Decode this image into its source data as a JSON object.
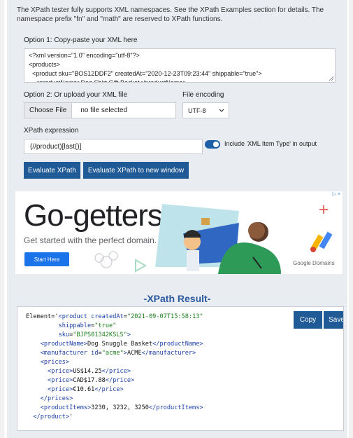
{
  "note": "The XPath tester fully supports XML namespaces. See the XPath Examples section for details. The namespace prefix \"fn\" and \"math\" are reserved to XPath functions.",
  "option1": {
    "label": "Option 1: Copy-paste your XML here",
    "xml_lines": [
      "<?xml version=\"1.0\" encoding=\"utf-8\"?>",
      "<products>",
      "  <product sku=\"BOS12DDF2\" createdAt=\"2020-12-23T09:23:44\" shippable=\"true\">",
      "    <productName>Dog Shirt Gift Basket</productName>"
    ]
  },
  "option2": {
    "label": "Option 2: Or upload your XML file",
    "choose_button": "Choose File",
    "no_file": "no file selected"
  },
  "encoding": {
    "label": "File encoding",
    "selected": "UTF-8"
  },
  "xpath": {
    "label": "XPath expression",
    "value": "(//product)[last()]",
    "toggle_label": "Include 'XML Item Type' in output",
    "toggle_on": true
  },
  "buttons": {
    "evaluate": "Evaluate XPath",
    "evaluate_new_window": "Evaluate XPath to new window"
  },
  "ad": {
    "headline": "Go-getters.",
    "subline": "Get started with the perfect domain.",
    "cta": "Start Here",
    "brand": "Google Domains"
  },
  "result": {
    "title": "-XPath Result-",
    "copy": "Copy",
    "save": "Save",
    "lines": [
      "Element='<product createdAt=\"2021-09-07T15:58:13\"",
      "         shippable=\"true\"",
      "         sku=\"BJPS01342KSLS\">",
      "    <productName>Dog Snuggle Basket</productName>",
      "    <manufacturer id=\"acme\">ACME</manufacturer>",
      "    <prices>",
      "      <price>US$14.25</price>",
      "      <price>CAD$17.88</price>",
      "      <price>€10.61</price>",
      "    </prices>",
      "    <productItems>3230, 3232, 3250</productItems>",
      "  </product>'"
    ]
  },
  "colors": {
    "accent": "#1f5a96",
    "result_title": "#2a5aa0",
    "background": "#e9ecf0"
  }
}
